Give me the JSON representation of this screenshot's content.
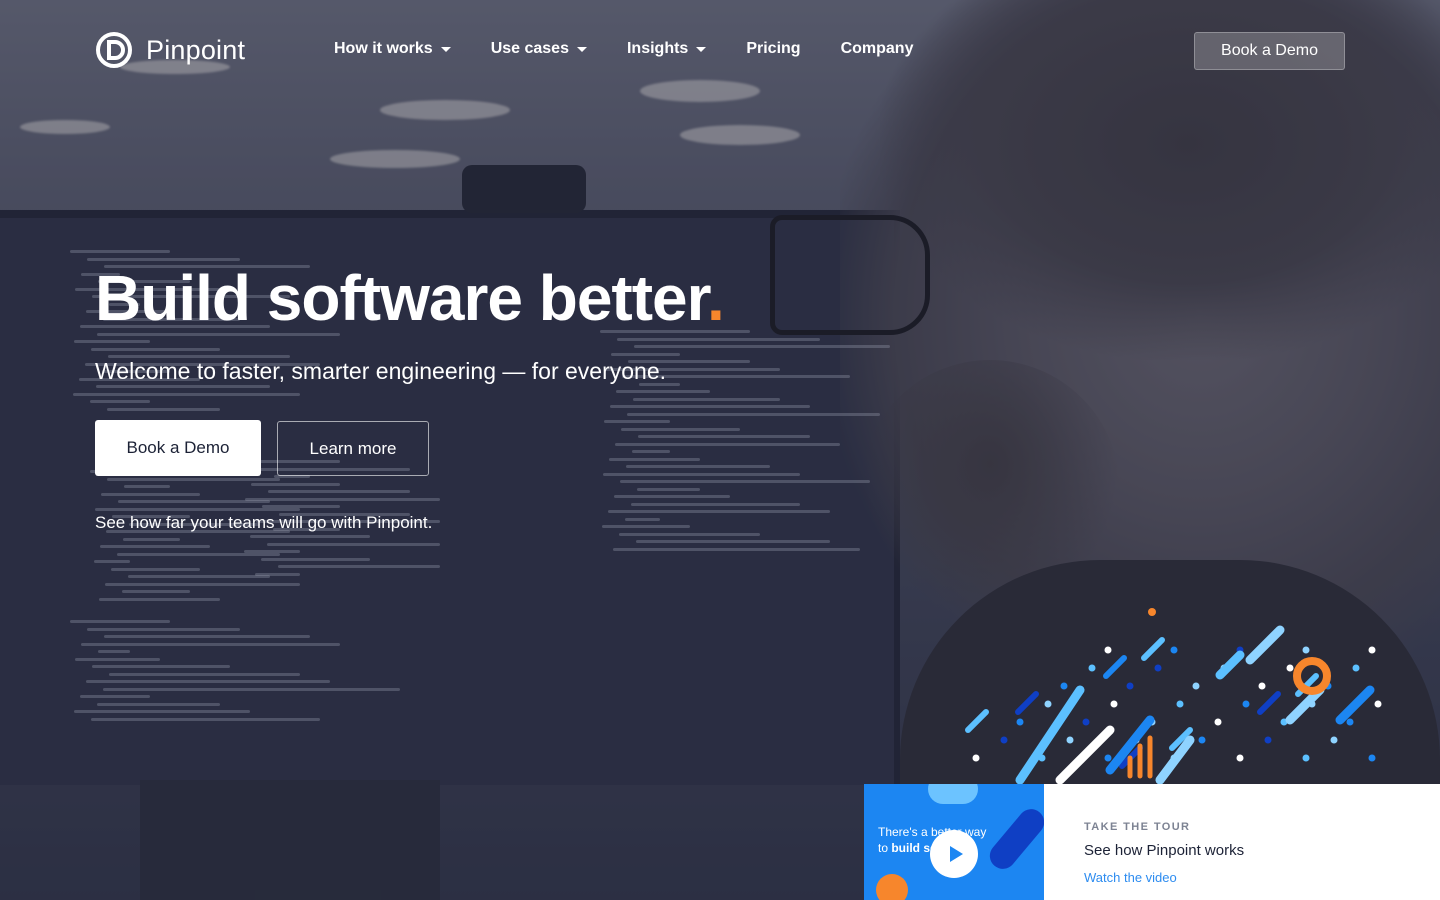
{
  "brand": {
    "name": "Pinpoint",
    "accent": "#f7862c",
    "link": "#2d8cf0"
  },
  "nav": {
    "items": [
      {
        "label": "How it works",
        "has_dropdown": true
      },
      {
        "label": "Use cases",
        "has_dropdown": true
      },
      {
        "label": "Insights",
        "has_dropdown": true
      },
      {
        "label": "Pricing",
        "has_dropdown": false
      },
      {
        "label": "Company",
        "has_dropdown": false
      }
    ],
    "cta_label": "Book a Demo"
  },
  "hero": {
    "title": "Build software better",
    "title_suffix": ".",
    "subtitle": "Welcome to faster, smarter engineering — for everyone.",
    "primary_button": "Book a Demo",
    "secondary_button": "Learn more",
    "note": "See how far your teams will go with Pinpoint."
  },
  "tour": {
    "kicker": "TAKE THE TOUR",
    "title": "See how Pinpoint works",
    "link": "Watch the video",
    "thumb_line1": "There's a better way",
    "thumb_line2_prefix": "to ",
    "thumb_line2_bold": "build software"
  }
}
